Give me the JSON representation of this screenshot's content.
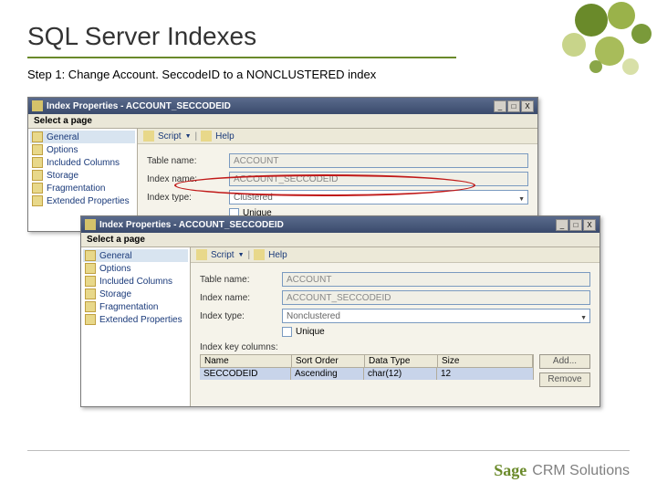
{
  "slide": {
    "title": "SQL Server Indexes",
    "step": "Step 1:  Change  Account. SeccodeID to a NONCLUSTERED index"
  },
  "win1": {
    "title": "Index Properties - ACCOUNT_SECCODEID",
    "select_page": "Select a page",
    "sidebar": [
      "General",
      "Options",
      "Included Columns",
      "Storage",
      "Fragmentation",
      "Extended Properties"
    ],
    "toolbar_script": "Script",
    "toolbar_help": "Help",
    "table_name_lbl": "Table name:",
    "table_name": "ACCOUNT",
    "index_name_lbl": "Index name:",
    "index_name": "ACCOUNT_SECCODEID",
    "index_type_lbl": "Index type:",
    "index_type": "Clustered",
    "unique_lbl": "Unique"
  },
  "win2": {
    "title": "Index Properties - ACCOUNT_SECCODEID",
    "select_page": "Select a page",
    "sidebar": [
      "General",
      "Options",
      "Included Columns",
      "Storage",
      "Fragmentation",
      "Extended Properties"
    ],
    "toolbar_script": "Script",
    "toolbar_help": "Help",
    "table_name_lbl": "Table name:",
    "table_name": "ACCOUNT",
    "index_name_lbl": "Index name:",
    "index_name": "ACCOUNT_SECCODEID",
    "index_type_lbl": "Index type:",
    "index_type": "Nonclustered",
    "unique_lbl": "Unique",
    "key_cols_lbl": "Index key columns:",
    "headers": {
      "name": "Name",
      "sort": "Sort Order",
      "dtype": "Data Type",
      "size": "Size"
    },
    "row": {
      "name": "SECCODEID",
      "sort": "Ascending",
      "dtype": "char(12)",
      "size": "12"
    },
    "add_btn": "Add...",
    "remove_btn": "Remove"
  },
  "footer": {
    "brand1": "Sage",
    "brand2": "CRM Solutions"
  }
}
